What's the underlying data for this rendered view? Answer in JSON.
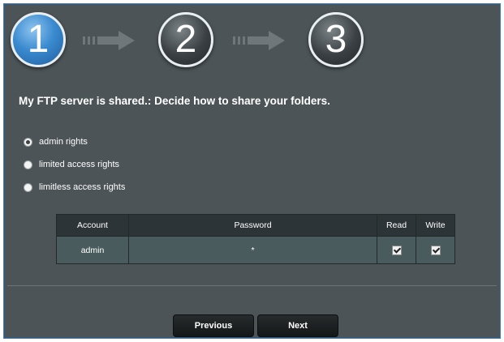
{
  "steps": [
    {
      "number": "1",
      "state": "active"
    },
    {
      "number": "2",
      "state": "inactive"
    },
    {
      "number": "3",
      "state": "inactive"
    }
  ],
  "heading": "My FTP server is shared.: Decide how to share your folders.",
  "access_options": [
    {
      "label": "admin rights",
      "selected": true
    },
    {
      "label": "limited access rights",
      "selected": false
    },
    {
      "label": "limitless access rights",
      "selected": false
    }
  ],
  "table": {
    "headers": [
      "Account",
      "Password",
      "Read",
      "Write"
    ],
    "rows": [
      {
        "account": "admin",
        "password": "*",
        "read": true,
        "write": true
      }
    ]
  },
  "buttons": {
    "previous": "Previous",
    "next": "Next"
  },
  "colors": {
    "background": "#4c5457",
    "active_step": "#3b8bd0",
    "frame_border": "#3a7fc0"
  },
  "icons": {
    "step_arrow": "right-arrow-icon",
    "checkbox": "checkbox-checked-icon"
  }
}
